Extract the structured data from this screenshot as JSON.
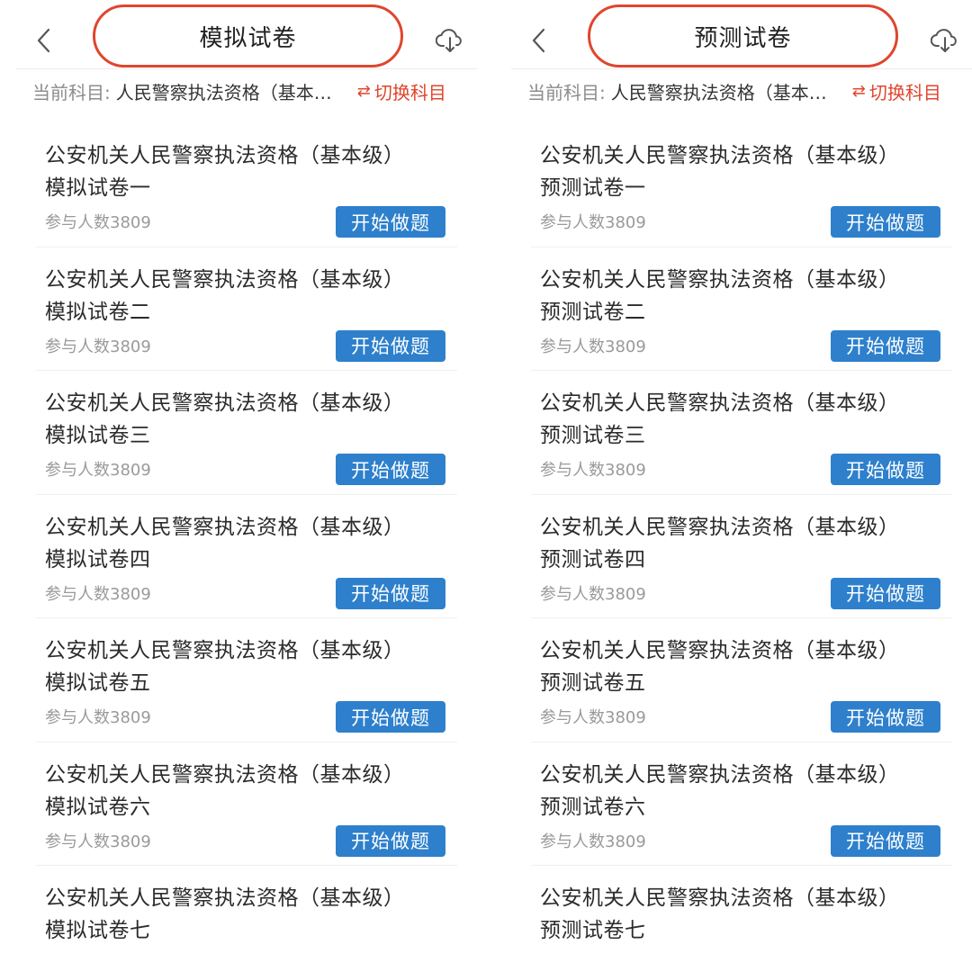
{
  "panels": [
    {
      "title": "模拟试卷",
      "subject_label": "当前科目:",
      "subject_value": "人民警察执法资格（基本…",
      "switch_label": "切换科目",
      "items": [
        {
          "line1": "公安机关人民警察执法资格（基本级）",
          "line2": "模拟试卷一",
          "count": "参与人数3809",
          "button": "开始做题"
        },
        {
          "line1": "公安机关人民警察执法资格（基本级）",
          "line2": "模拟试卷二",
          "count": "参与人数3809",
          "button": "开始做题"
        },
        {
          "line1": "公安机关人民警察执法资格（基本级）",
          "line2": "模拟试卷三",
          "count": "参与人数3809",
          "button": "开始做题"
        },
        {
          "line1": "公安机关人民警察执法资格（基本级）",
          "line2": "模拟试卷四",
          "count": "参与人数3809",
          "button": "开始做题"
        },
        {
          "line1": "公安机关人民警察执法资格（基本级）",
          "line2": "模拟试卷五",
          "count": "参与人数3809",
          "button": "开始做题"
        },
        {
          "line1": "公安机关人民警察执法资格（基本级）",
          "line2": "模拟试卷六",
          "count": "参与人数3809",
          "button": "开始做题"
        },
        {
          "line1": "公安机关人民警察执法资格（基本级）",
          "line2": "模拟试卷七",
          "count": "",
          "button": ""
        }
      ]
    },
    {
      "title": "预测试卷",
      "subject_label": "当前科目:",
      "subject_value": "人民警察执法资格（基本…",
      "switch_label": "切换科目",
      "items": [
        {
          "line1": "公安机关人民警察执法资格（基本级）",
          "line2": "预测试卷一",
          "count": "参与人数3809",
          "button": "开始做题"
        },
        {
          "line1": "公安机关人民警察执法资格（基本级）",
          "line2": "预测试卷二",
          "count": "参与人数3809",
          "button": "开始做题"
        },
        {
          "line1": "公安机关人民警察执法资格（基本级）",
          "line2": "预测试卷三",
          "count": "参与人数3809",
          "button": "开始做题"
        },
        {
          "line1": "公安机关人民警察执法资格（基本级）",
          "line2": "预测试卷四",
          "count": "参与人数3809",
          "button": "开始做题"
        },
        {
          "line1": "公安机关人民警察执法资格（基本级）",
          "line2": "预测试卷五",
          "count": "参与人数3809",
          "button": "开始做题"
        },
        {
          "line1": "公安机关人民警察执法资格（基本级）",
          "line2": "预测试卷六",
          "count": "参与人数3809",
          "button": "开始做题"
        },
        {
          "line1": "公安机关人民警察执法资格（基本级）",
          "line2": "预测试卷七",
          "count": "",
          "button": ""
        }
      ]
    }
  ],
  "colors": {
    "highlight": "#e0452d",
    "button": "#2e80cc",
    "muted": "#9a9a9a"
  },
  "icons": {
    "back": "chevron-left-icon",
    "download": "cloud-download-icon",
    "switch": "swap-arrows-icon"
  }
}
